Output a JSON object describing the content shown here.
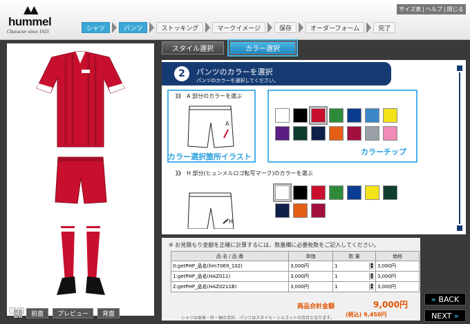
{
  "brand": {
    "name": "hummel",
    "tagline": "Character since 1923"
  },
  "utility": {
    "size_chart": "サイズ表",
    "help": "ヘルプ",
    "close": "閉じる",
    "sep": "|"
  },
  "steps": [
    "シャツ",
    "パンツ",
    "ストッキング",
    "マークイメージ",
    "保存",
    "オーダーフォーム",
    "完了"
  ],
  "tabs": {
    "style": "スタイル選択",
    "color": "カラー選択"
  },
  "panel": {
    "number": "2",
    "title": "パンツのカラーを選択",
    "subtitle": "パンツのカラーを選択してください。"
  },
  "section_a": {
    "marker": "》》",
    "label": "A 部分のカラーを選ぶ",
    "illust_callout": "カラー選択箇所イラスト",
    "chip_callout": "カラーチップ",
    "illust_marker": "A"
  },
  "section_h": {
    "marker": "》》",
    "label": "H 部分(ヒュンメルロゴ転写マーク)のカラーを選ぶ",
    "illust_marker": "H"
  },
  "colors_a": [
    "#ffffff",
    "#000000",
    "#c8102e",
    "#2e8b3a",
    "#0a3d91",
    "#3a86c8",
    "#f5e31a",
    "#5b1e82",
    "#0f3d2e",
    "#0f2148",
    "#e35f15",
    "#a3103e",
    "#9aa0a6",
    "#f08bb5"
  ],
  "colors_h": [
    "#ffffff",
    "#000000",
    "#c8102e",
    "#2e8b3a",
    "#0a3d91",
    "#f5e31a",
    "#0f3d2e",
    "#0f2148",
    "#e35f15",
    "#a3103e"
  ],
  "price": {
    "note": "※ お見積もり金額を正確に計算するには、数量欄に必要枚数をご記入してください。",
    "headers": [
      "品 名 / 品 番",
      "単価",
      "数 量",
      "価格"
    ],
    "rows": [
      {
        "name": "0:getPHP_品名(hm7069_102)",
        "unit": "3,000円",
        "qty": "1",
        "price": "3,000円"
      },
      {
        "name": "1:getPHP_品名(HAZ011)",
        "unit": "3,000円",
        "qty": "1",
        "price": "3,000円"
      },
      {
        "name": "2:getPHP_品名(HAZ0211B)",
        "unit": "3,000円",
        "qty": "1",
        "price": "3,000円"
      }
    ],
    "total_label": "商品合計金額",
    "total": "9,000円",
    "tax": "(税込) 9,450円",
    "footnote": "シャツは本体・衿・袖の合計、パンツはスタイル・シルエットの合計となります。"
  },
  "nav": {
    "front": "前面",
    "preview": "プレビュー",
    "back_view": "背面",
    "back": "BACK",
    "next": "NEXT"
  }
}
